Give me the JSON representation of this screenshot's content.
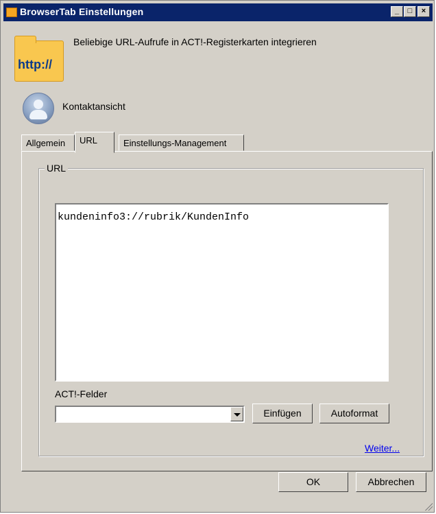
{
  "window": {
    "title": "BrowserTab Einstellungen",
    "controls": {
      "minimize": "_",
      "maximize": "□",
      "close": "×"
    }
  },
  "header": {
    "icon_text": "http://",
    "description": "Beliebige URL-Aufrufe in ACT!-Registerkarten integrieren"
  },
  "context": {
    "label": "Kontaktansicht"
  },
  "tabs": [
    {
      "label": "Allgemein",
      "active": false
    },
    {
      "label": "URL",
      "active": true
    },
    {
      "label": "Einstellungs-Management",
      "active": false
    }
  ],
  "url_group": {
    "label": "URL",
    "value": "kundeninfo3://rubrik/KundenInfo"
  },
  "fields": {
    "label": "ACT!-Felder",
    "selected": "",
    "insert_button": "Einfügen",
    "autoformat_button": "Autoformat"
  },
  "more_link": "Weiter...",
  "footer": {
    "ok": "OK",
    "cancel": "Abbrechen"
  }
}
